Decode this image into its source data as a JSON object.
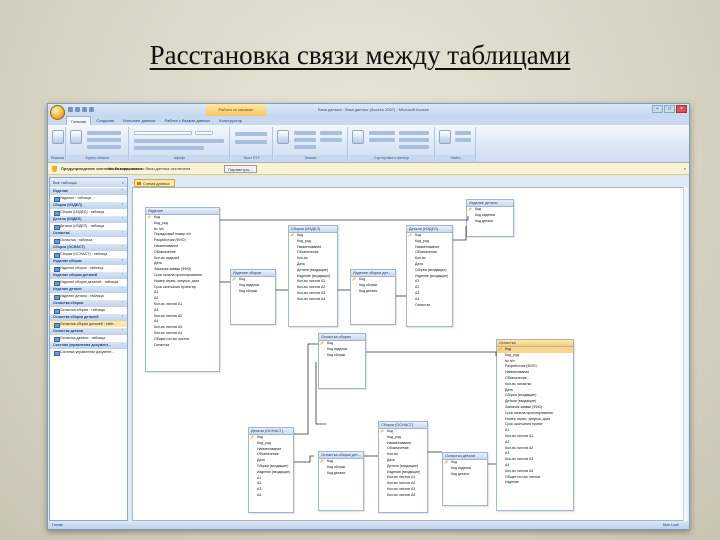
{
  "slide_title": "Расстановка связи между таблицами",
  "window": {
    "title": "База данных : база данных (Access 2007) - Microsoft Access",
    "contextual_tab": "Работа со связями",
    "tabs": [
      "Главная",
      "Создание",
      "Внешние данные",
      "Работа с базами данных",
      "Конструктор"
    ],
    "ribbon_groups": [
      "Режимы",
      "Буфер обмена",
      "Шрифт",
      "Текст RTF",
      "Записи",
      "Сортировка и фильтр",
      "Найти"
    ]
  },
  "security_bar": {
    "title": "Предупреждение системы безопасности",
    "message": "Часть содержимого базы данных отключена",
    "button": "Параметры..."
  },
  "nav_pane": {
    "header": "Все таблицы",
    "groups": [
      {
        "name": "Изделие",
        "items": [
          "Изделие : таблица"
        ]
      },
      {
        "name": "Сборки (ИЗДЕЛ)",
        "items": [
          "Сборки (ИЗДЕЛ) : таблица"
        ]
      },
      {
        "name": "Детали (ИЗДЕЛ)",
        "items": [
          "Детали (ИЗДЕЛ) : таблица"
        ]
      },
      {
        "name": "Оснастка",
        "items": [
          "Оснастка : таблица"
        ]
      },
      {
        "name": "Сборки (ОСНАСТ)",
        "items": [
          "Сборки (ОСНАСТ) : таблица"
        ]
      },
      {
        "name": "Изделие сборки",
        "items": [
          "Изделие сборки : таблица"
        ]
      },
      {
        "name": "Изделие сборки деталей",
        "items": [
          "Изделие сборки деталей : таблица"
        ]
      },
      {
        "name": "Изделие детали",
        "items": [
          "Изделие детали : таблица"
        ]
      },
      {
        "name": "Оснастка сборки",
        "items": [
          "Оснастка сборки : таблица"
        ]
      },
      {
        "name": "Оснастка сборки деталей",
        "items": [
          "Оснастка сборки деталей : табл..."
        ]
      },
      {
        "name": "Оснастка детали",
        "items": [
          "Оснастка детали : таблица"
        ]
      },
      {
        "name": "Система управления документ...",
        "items": [
          "Система управления документ..."
        ]
      }
    ]
  },
  "doc_tab": "Схема данных",
  "status": {
    "left": "Готово",
    "right": "Num Lock"
  },
  "relationship_tables": [
    {
      "title": "Изделие",
      "fields": [
        "Код",
        "Код_род",
        "№ п/п",
        "Порядковый номер п/п",
        "Разработчик (ФИО)",
        "Наименование",
        "Обозначение",
        "Кол-во изделий",
        "Дата",
        "Заказчик заявки (ФИО)",
        "Срок начала проектирования",
        "Номер серии, запуска, дата",
        "Срок окончания проектир",
        "А1",
        "А2",
        "Кол-во листов А1",
        "А3",
        "Кол-во листов А2",
        "А4",
        "Кол-во листов А3",
        "Кол-во листов А4",
        "Общее кол-во листов",
        "Оснастка"
      ]
    },
    {
      "title": "Изделие сборки",
      "fields": [
        "Код",
        "Код изделия",
        "Код сборки"
      ]
    },
    {
      "title": "Сборки (ИЗДЕЛ)",
      "fields": [
        "Код",
        "Код_род",
        "Наименование",
        "Обозначение",
        "Кол-во",
        "Дата",
        "Детали (входящие)",
        "Изделие (входящие)",
        "Кол-во листов А1",
        "Кол-во листов А2",
        "Кол-во листов А3",
        "Кол-во листов А4"
      ]
    },
    {
      "title": "Изделие сборки дет...",
      "fields": [
        "Код",
        "Код сборки",
        "Код детали"
      ]
    },
    {
      "title": "Детали (ИЗДЕЛ)",
      "fields": [
        "Код",
        "Код_род",
        "Наименование",
        "Обозначение",
        "Кол-во",
        "Дата",
        "Сборки (входящие)",
        "Изделие (входящие)",
        "А1",
        "А2",
        "А3",
        "А4",
        "Оснастка"
      ]
    },
    {
      "title": "Изделие детали",
      "fields": [
        "Код",
        "Код изделия",
        "Код детали"
      ]
    },
    {
      "title": "Оснастка сборки",
      "fields": [
        "Код",
        "Код изделия",
        "Код сборки"
      ]
    },
    {
      "title": "Оснастка",
      "fields": [
        "Код",
        "Код_род",
        "№ п/п",
        "Разработчик (ФИО)",
        "Наименование",
        "Обозначение",
        "Кол-во оснастки",
        "Дата",
        "Сборки (входящие)",
        "Детали (входящие)",
        "Заказчик заявки (ФИО)",
        "Срок начала проектирования",
        "Номер серии, запуска, дата",
        "Срок окончания проект",
        "А1",
        "Кол-во листов А1",
        "А2",
        "Кол-во листов А2",
        "А3",
        "Кол-во листов А3",
        "А4",
        "Кол-во листов А4",
        "Общее кол-во листов",
        "Изделие"
      ]
    },
    {
      "title": "Детали (ОСНАСТ)",
      "fields": [
        "Код",
        "Код_род",
        "Наименование",
        "Обозначение",
        "Дата",
        "Сборки (входящие)",
        "Изделия (входящие)",
        "А1",
        "А2",
        "А3",
        "А4"
      ]
    },
    {
      "title": "Оснастка сборки дет...",
      "fields": [
        "Код",
        "Код сборки",
        "Код детали"
      ]
    },
    {
      "title": "Сборки (ОСНАСТ)",
      "fields": [
        "Код",
        "Код_род",
        "Наименование",
        "Обозначение",
        "Кол-во",
        "Дата",
        "Детали (входящие)",
        "Изделия (входящие)",
        "Кол-во листов А1",
        "Кол-во листов А2",
        "Кол-во листов А3",
        "Кол-во листов А4"
      ]
    },
    {
      "title": "Оснастка детали",
      "fields": [
        "Код",
        "Код изделия",
        "Код детали"
      ]
    }
  ]
}
